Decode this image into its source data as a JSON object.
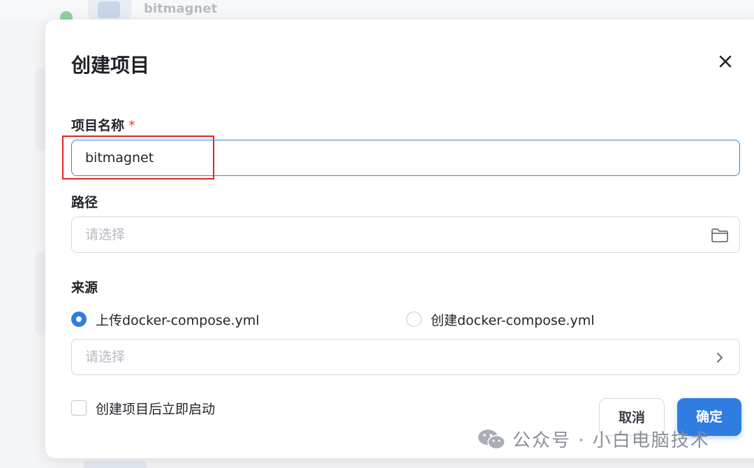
{
  "background": {
    "app_name": "bitmagnet"
  },
  "dialog": {
    "title": "创建项目",
    "close_icon": "close-icon",
    "name_field": {
      "label": "项目名称",
      "required_mark": "*",
      "value": "bitmagnet"
    },
    "path_field": {
      "label": "路径",
      "placeholder": "请选择",
      "icon": "folder-icon"
    },
    "source": {
      "label": "来源",
      "options": [
        {
          "label": "上传docker-compose.yml",
          "selected": true
        },
        {
          "label": "创建docker-compose.yml",
          "selected": false
        }
      ],
      "select_placeholder": "请选择",
      "select_icon": "chevron-right-icon"
    },
    "autostart_checkbox": {
      "label": "创建项目后立即启动",
      "checked": false
    },
    "buttons": {
      "cancel": "取消",
      "confirm": "确定"
    }
  },
  "watermark": {
    "text": "公众号 · 小白电脑技术"
  },
  "colors": {
    "accent": "#2f7de1",
    "highlight_box": "#e02424",
    "required": "#e03f3f"
  }
}
